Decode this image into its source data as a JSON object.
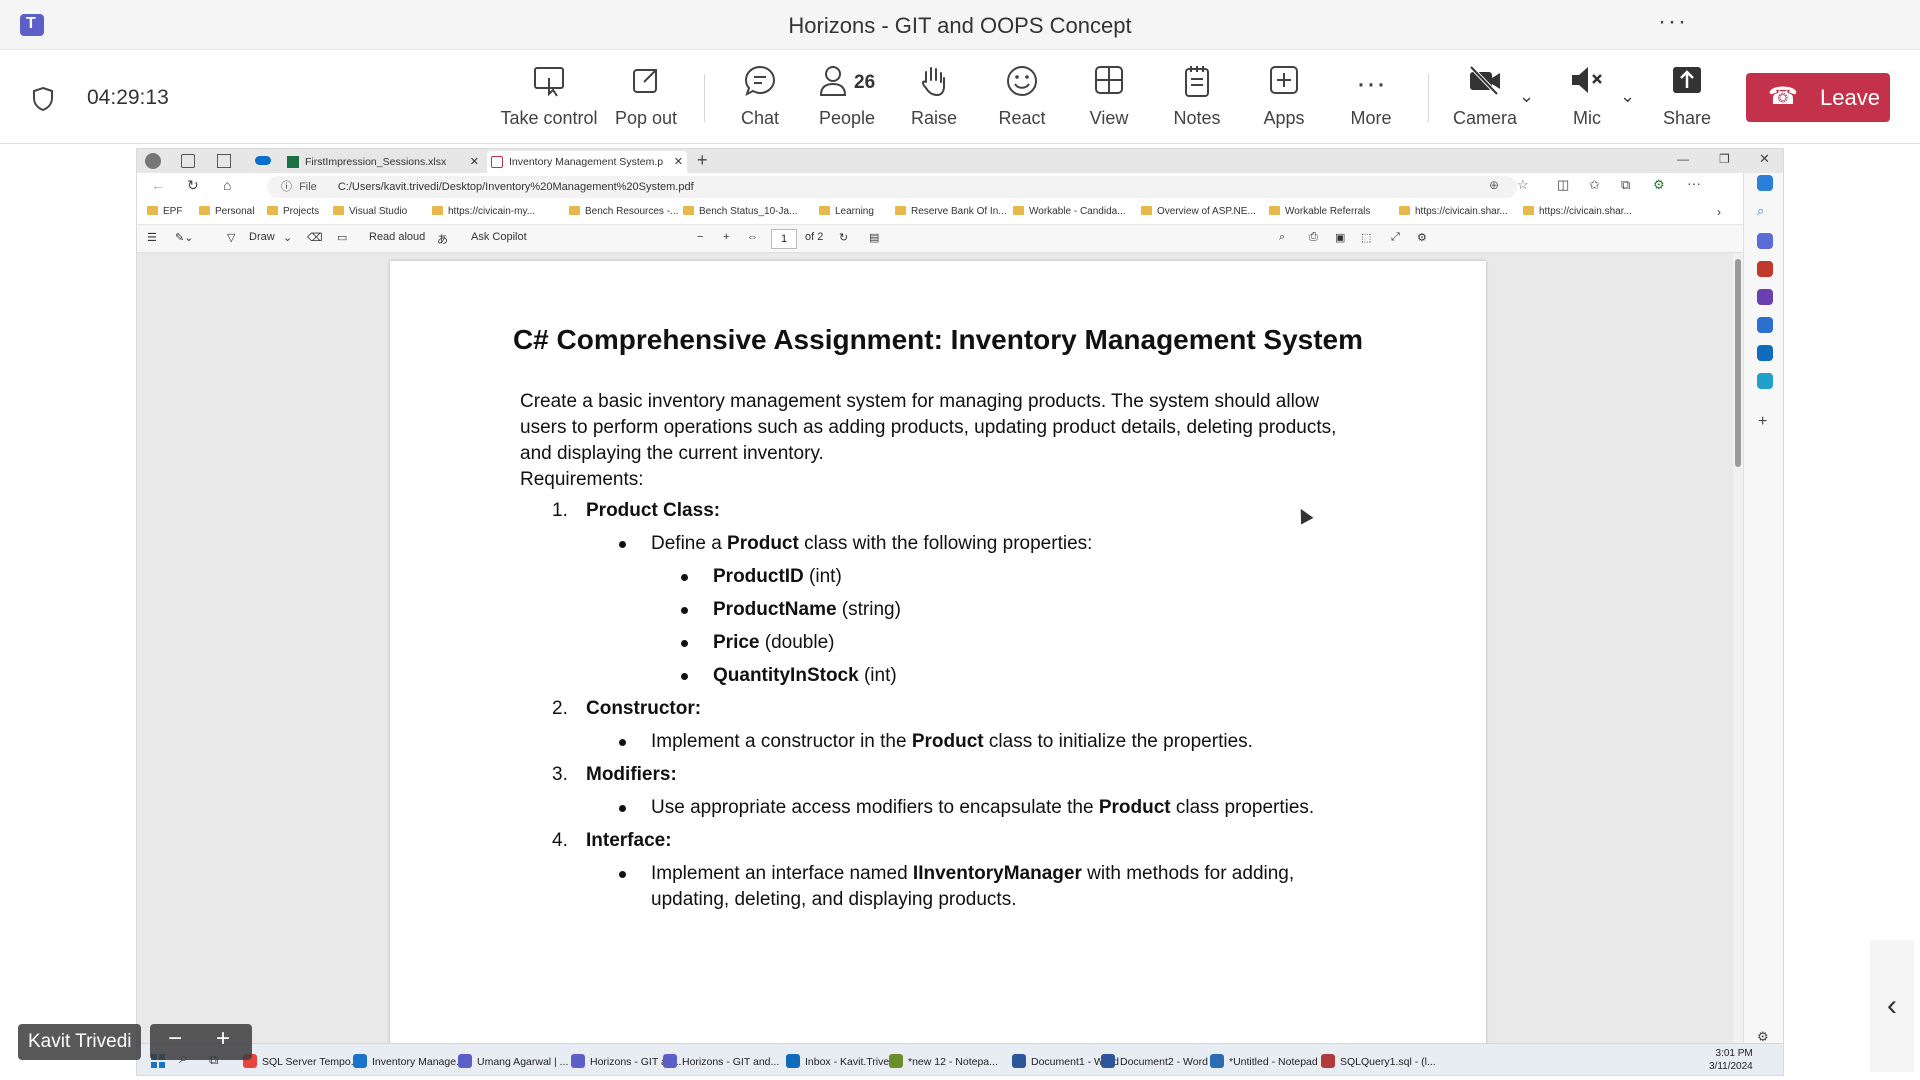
{
  "window": {
    "title": "Horizons - GIT and OOPS Concept",
    "more": "···"
  },
  "meeting": {
    "timer": "04:29:13",
    "buttons": {
      "take_control": "Take control",
      "pop_out": "Pop out",
      "chat": "Chat",
      "people": "People",
      "people_count": "26",
      "raise": "Raise",
      "react": "React",
      "view": "View",
      "notes": "Notes",
      "apps": "Apps",
      "more": "More",
      "camera": "Camera",
      "mic": "Mic",
      "share": "Share",
      "leave": "Leave"
    },
    "presenter_name": "Kavit Trivedi",
    "zoom_minus": "−",
    "zoom_plus": "+"
  },
  "browser": {
    "tabs": [
      {
        "label": "FirstImpression_Sessions.xlsx"
      },
      {
        "label": "Inventory Management System.p"
      }
    ],
    "address_label": "File",
    "address": "C:/Users/kavit.trivedi/Desktop/Inventory%20Management%20System.pdf",
    "bookmarks": [
      "EPF",
      "Personal",
      "Projects",
      "Visual Studio",
      "https://civicain-my...",
      "Bench Resources -...",
      "Bench Status_10-Ja...",
      "Learning",
      "Reserve Bank Of In...",
      "Workable - Candida...",
      "Overview of ASP.NE...",
      "Workable Referrals",
      "https://civicain.shar...",
      "https://civicain.shar..."
    ]
  },
  "pdf_toolbar": {
    "draw": "Draw",
    "read_aloud": "Read aloud",
    "ask_copilot": "Ask Copilot",
    "page_current": "1",
    "page_total": "of 2"
  },
  "document": {
    "title": "C# Comprehensive Assignment: Inventory Management System",
    "intro": "Create a basic inventory management system for managing products. The system should allow users to perform operations such as adding products, updating product details, deleting products, and displaying the current inventory.",
    "requirements_label": "Requirements:",
    "items": [
      {
        "num": "1.",
        "heading": "Product Class:"
      },
      {
        "num": "2.",
        "heading": "Constructor:"
      },
      {
        "num": "3.",
        "heading": "Modifiers:"
      },
      {
        "num": "4.",
        "heading": "Interface:"
      }
    ],
    "product_define_pre": "Define a ",
    "product_define_bold": "Product",
    "product_define_post": " class with the following properties:",
    "properties": [
      {
        "name": "ProductID",
        "type": " (int)"
      },
      {
        "name": "ProductName",
        "type": " (string)"
      },
      {
        "name": "Price",
        "type": " (double)"
      },
      {
        "name": "QuantityInStock",
        "type": " (int)"
      }
    ],
    "constructor_pre": "Implement a constructor in the ",
    "constructor_bold": "Product",
    "constructor_post": " class to initialize the properties.",
    "modifiers_pre": "Use appropriate access modifiers to encapsulate the ",
    "modifiers_bold": "Product",
    "modifiers_post": " class properties.",
    "interface_pre": "Implement an interface named ",
    "interface_bold": "IInventoryManager",
    "interface_post": " with methods for adding,",
    "interface_line2": "updating, deleting, and displaying products."
  },
  "taskbar": {
    "items": [
      "SQL Server Tempo...",
      "Inventory Manage...",
      "Umang Agarwal | ...",
      "Horizons - GIT an...",
      "Horizons - GIT and...",
      "Inbox - Kavit.Trive...",
      "*new 12 - Notepa...",
      "Document1 - Word",
      "Document2 - Word",
      "*Untitled - Notepad",
      "SQLQuery1.sql - (l..."
    ],
    "time": "3:01 PM",
    "date": "3/11/2024"
  }
}
